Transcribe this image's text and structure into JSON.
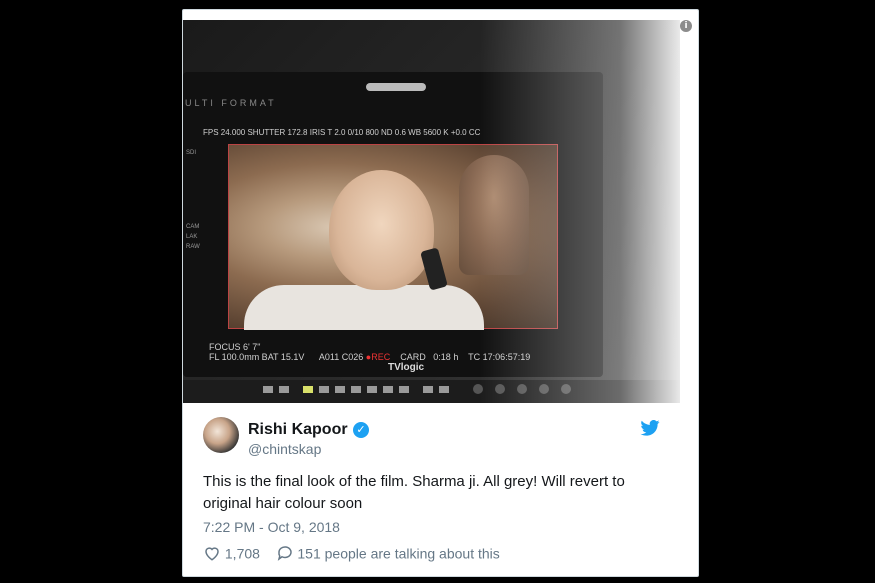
{
  "media": {
    "info_icon": "info-icon",
    "monitor_label": "ULTI FORMAT",
    "hud_top": "FPS 24.000   SHUTTER 172.8   IRIS T 2.0  0/10    800  ND 0.6     WB  5600 K  +0.0 CC",
    "hud_bottom_left": "FOCUS   6' 7\"",
    "hud_bottom_left2": "FL 100.0mm   BAT 15.1V",
    "hud_bottom_clip": "A011 C026",
    "hud_bottom_rec": "●REC",
    "hud_bottom_card": "CARD",
    "hud_bottom_remain": "0:18 h",
    "hud_bottom_tc": "TC 17:06:57:19",
    "brand": "TVlogic",
    "side_labels": [
      "SDI",
      "CAM",
      "LAK",
      "RAW"
    ]
  },
  "tweet": {
    "name": "Rishi Kapoor",
    "handle": "@chintskap",
    "text": "This is the final look of the film.  Sharma ji. All grey! Will revert to original hair colour soon",
    "timestamp": "7:22 PM - Oct 9, 2018",
    "likes": "1,708",
    "replies": "151 people are talking about this",
    "icons": {
      "verified": "verified-badge-icon",
      "bird": "twitter-bird-icon",
      "heart": "heart-icon",
      "reply": "reply-bubble-icon"
    },
    "colors": {
      "accent": "#1da1f2",
      "muted": "#657786",
      "text": "#14171a"
    }
  }
}
